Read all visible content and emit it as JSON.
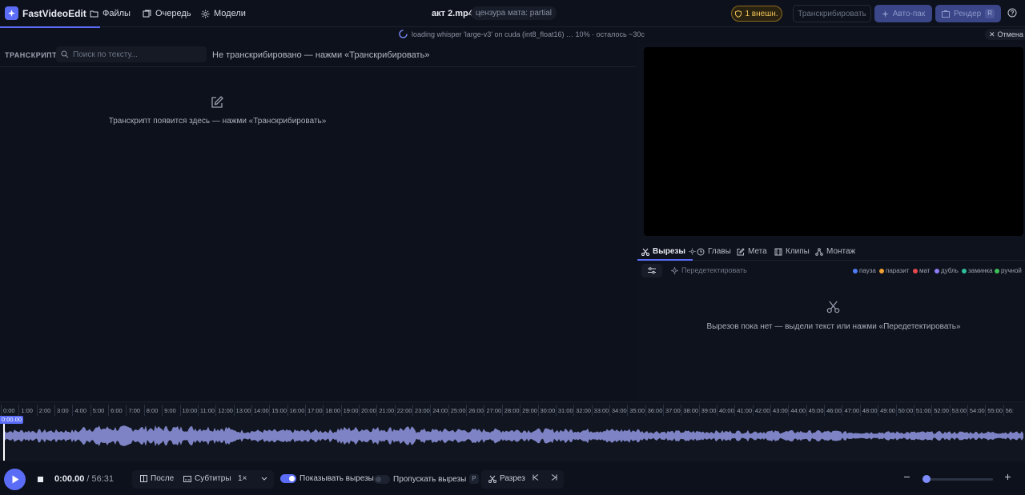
{
  "app": {
    "title": "FastVideoEdit"
  },
  "nav": [
    {
      "label": "Файлы",
      "icon": "folder-icon"
    },
    {
      "label": "Очередь",
      "icon": "queue-icon"
    },
    {
      "label": "Модели",
      "icon": "gear-icon"
    }
  ],
  "header": {
    "file_name": "акт 2.mp4",
    "censor_mode": "цензура мата: partial",
    "external_badge": "1 внешн.",
    "transcribe_label": "Транскрибировать",
    "autocut_label": "Авто-пак",
    "render_label": "Рендер",
    "render_shortcut": "R"
  },
  "progress": {
    "text": "loading whisper 'large-v3' on cuda (int8_float16) … 10% · осталось ~30с",
    "percent": 10,
    "cancel_label": "Отмена"
  },
  "transcript": {
    "section_label": "ТРАНСКРИПТ",
    "search_placeholder": "Поиск по тексту...",
    "status": "Не транскрибировано — нажми «Транскрибировать»",
    "empty_text": "Транскрипт появится здесь — нажми «Транскрибировать»"
  },
  "right_tabs": [
    {
      "label": "Вырезы",
      "icon": "scissors-icon",
      "active": true
    },
    {
      "label": "Главы",
      "icon": "clock-icon"
    },
    {
      "label": "Мета",
      "icon": "edit-icon"
    },
    {
      "label": "Клипы",
      "icon": "film-icon"
    },
    {
      "label": "Монтаж",
      "icon": "montage-icon"
    }
  ],
  "cuts": {
    "redetect_label": "Передетектировать",
    "empty_text": "Вырезов пока нет — выдели текст или нажми «Передетектировать»",
    "legend": [
      {
        "label": "пауза",
        "color": "#4f7cf7"
      },
      {
        "label": "паразит",
        "color": "#f0a030"
      },
      {
        "label": "мат",
        "color": "#e5484d"
      },
      {
        "label": "дубль",
        "color": "#8e7cf7"
      },
      {
        "label": "заминка",
        "color": "#2fbf9a"
      },
      {
        "label": "ручной",
        "color": "#3fbf5a"
      }
    ]
  },
  "timeline": {
    "ticks": [
      "0:00",
      "1:00",
      "2:00",
      "3:00",
      "4:00",
      "5:00",
      "6:00",
      "7:00",
      "8:00",
      "9:00",
      "10:00",
      "11:00",
      "12:00",
      "13:00",
      "14:00",
      "15:00",
      "16:00",
      "17:00",
      "18:00",
      "19:00",
      "20:00",
      "21:00",
      "22:00",
      "23:00",
      "24:00",
      "25:00",
      "26:00",
      "27:00",
      "28:00",
      "29:00",
      "30:00",
      "31:00",
      "32:00",
      "33:00",
      "34:00",
      "35:00",
      "36:00",
      "37:00",
      "38:00",
      "39:00",
      "40:00",
      "41:00",
      "42:00",
      "43:00",
      "44:00",
      "45:00",
      "46:00",
      "47:00",
      "48:00",
      "49:00",
      "50:00",
      "51:00",
      "52:00",
      "53:00",
      "54:00",
      "55:00",
      "56:"
    ],
    "playhead_label": "0:00.00"
  },
  "transport": {
    "current_time": "0:00.00",
    "total_time": "/ 56:31",
    "after_label": "После",
    "subtitles_label": "Субтитры",
    "speed": "1×",
    "show_cuts_label": "Показывать вырезы",
    "show_cuts_on": true,
    "skip_cuts_label": "Пропускать вырезы",
    "skip_cuts_on": false,
    "skip_cuts_shortcut": "P",
    "split_label": "Разрез",
    "zoom_level": 0.02
  },
  "colors": {
    "accent": "#5b6df7",
    "background": "#0d111b",
    "waveform": "#8a8fd6"
  }
}
